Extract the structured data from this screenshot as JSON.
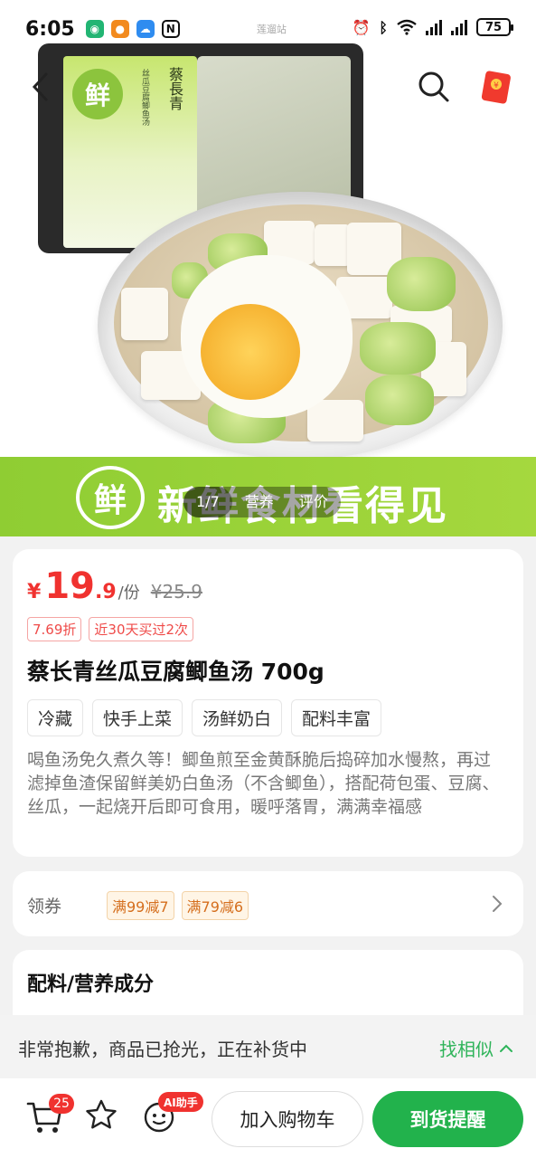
{
  "status_bar": {
    "time": "6:05",
    "carrier": "莲遛站",
    "battery": "75",
    "icons": [
      "xiaomi-app-icon",
      "chat-app-icon",
      "weather-app-icon",
      "nfc-icon",
      "alarm-icon",
      "bluetooth-icon",
      "wifi-icon",
      "signal-icon",
      "signal-icon"
    ]
  },
  "hero": {
    "pack_logo_char": "鲜",
    "pack_brand": "蔡長青",
    "pack_subtitle": "丝瓜豆腐鲫鱼汤",
    "banner_logo_char": "鲜",
    "banner_text": "新鲜食材看得见",
    "image_tabs": [
      {
        "label": "1/7",
        "active": true
      },
      {
        "label": "营养",
        "active": false
      },
      {
        "label": "评价",
        "active": false
      }
    ]
  },
  "nav": {
    "back_icon": "chevron-left-icon",
    "search_icon": "search-icon",
    "redpacket_icon": "red-packet-icon"
  },
  "product": {
    "price_symbol": "¥",
    "price_int": "19",
    "price_dec": ".9",
    "price_unit": "/份",
    "original_price": "¥25.9",
    "discount_tag": "7.69折",
    "sales_tag": "近30天买过2次",
    "title": "蔡长青丝瓜豆腐鲫鱼汤 700g",
    "features": [
      "冷藏",
      "快手上菜",
      "汤鲜奶白",
      "配料丰富"
    ],
    "description": "喝鱼汤免久煮久等！鲫鱼煎至金黄酥脆后捣碎加水慢熬，再过滤掉鱼渣保留鲜美奶白鱼汤（不含鲫鱼），搭配荷包蛋、豆腐、丝瓜，一起烧开后即可食用，暖呼落胃，满满幸福感"
  },
  "coupons": {
    "label": "领券",
    "items": [
      "满99减7",
      "满79减6"
    ]
  },
  "ingredients": {
    "title": "配料/营养成分"
  },
  "soldout": {
    "message": "非常抱歉，商品已抢光，正在补货中",
    "similar_label": "找相似"
  },
  "actions": {
    "cart_badge": "25",
    "ai_badge": "AI助手",
    "add_cart_label": "加入购物车",
    "notify_label": "到货提醒"
  },
  "colors": {
    "price_red": "#f0322f",
    "brand_green": "#22b24c",
    "banner_green": "#8fcd33"
  }
}
